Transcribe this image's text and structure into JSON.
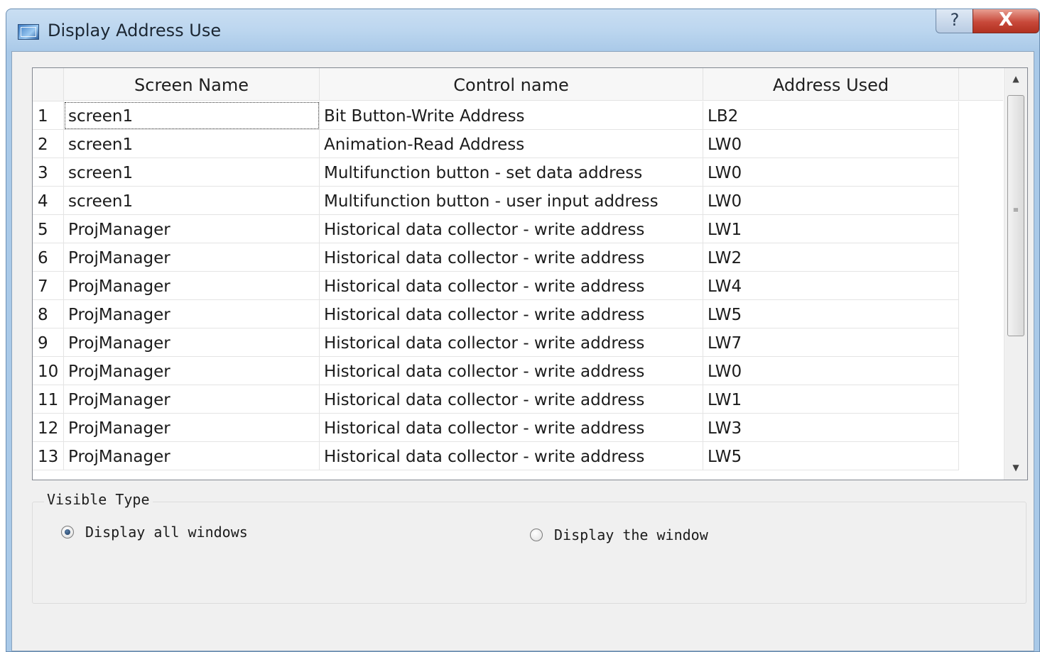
{
  "window": {
    "title": "Display Address Use",
    "help_label": "?",
    "close_label": "X"
  },
  "table": {
    "columns": [
      "Screen Name",
      "Control name",
      "Address Used"
    ],
    "rows": [
      {
        "num": "1",
        "screen": "screen1",
        "control": "Bit Button-Write Address",
        "address": "LB2"
      },
      {
        "num": "2",
        "screen": "screen1",
        "control": "Animation-Read Address",
        "address": "LW0"
      },
      {
        "num": "3",
        "screen": "screen1",
        "control": "Multifunction button - set data address",
        "address": "LW0"
      },
      {
        "num": "4",
        "screen": "screen1",
        "control": "Multifunction button - user input address",
        "address": "LW0"
      },
      {
        "num": "5",
        "screen": "ProjManager",
        "control": "Historical data collector - write address",
        "address": "LW1"
      },
      {
        "num": "6",
        "screen": "ProjManager",
        "control": "Historical data collector - write address",
        "address": "LW2"
      },
      {
        "num": "7",
        "screen": "ProjManager",
        "control": "Historical data collector - write address",
        "address": "LW4"
      },
      {
        "num": "8",
        "screen": "ProjManager",
        "control": "Historical data collector - write address",
        "address": "LW5"
      },
      {
        "num": "9",
        "screen": "ProjManager",
        "control": "Historical data collector - write address",
        "address": "LW7"
      },
      {
        "num": "10",
        "screen": "ProjManager",
        "control": "Historical data collector - write address",
        "address": "LW0"
      },
      {
        "num": "11",
        "screen": "ProjManager",
        "control": "Historical data collector - write address",
        "address": "LW1"
      },
      {
        "num": "12",
        "screen": "ProjManager",
        "control": "Historical data collector - write address",
        "address": "LW3"
      },
      {
        "num": "13",
        "screen": "ProjManager",
        "control": "Historical data collector - write address",
        "address": "LW5"
      }
    ]
  },
  "visible_type": {
    "legend": "Visible Type",
    "options": [
      {
        "label": "Display all windows",
        "checked": true
      },
      {
        "label": "Display the window",
        "checked": false
      }
    ]
  }
}
